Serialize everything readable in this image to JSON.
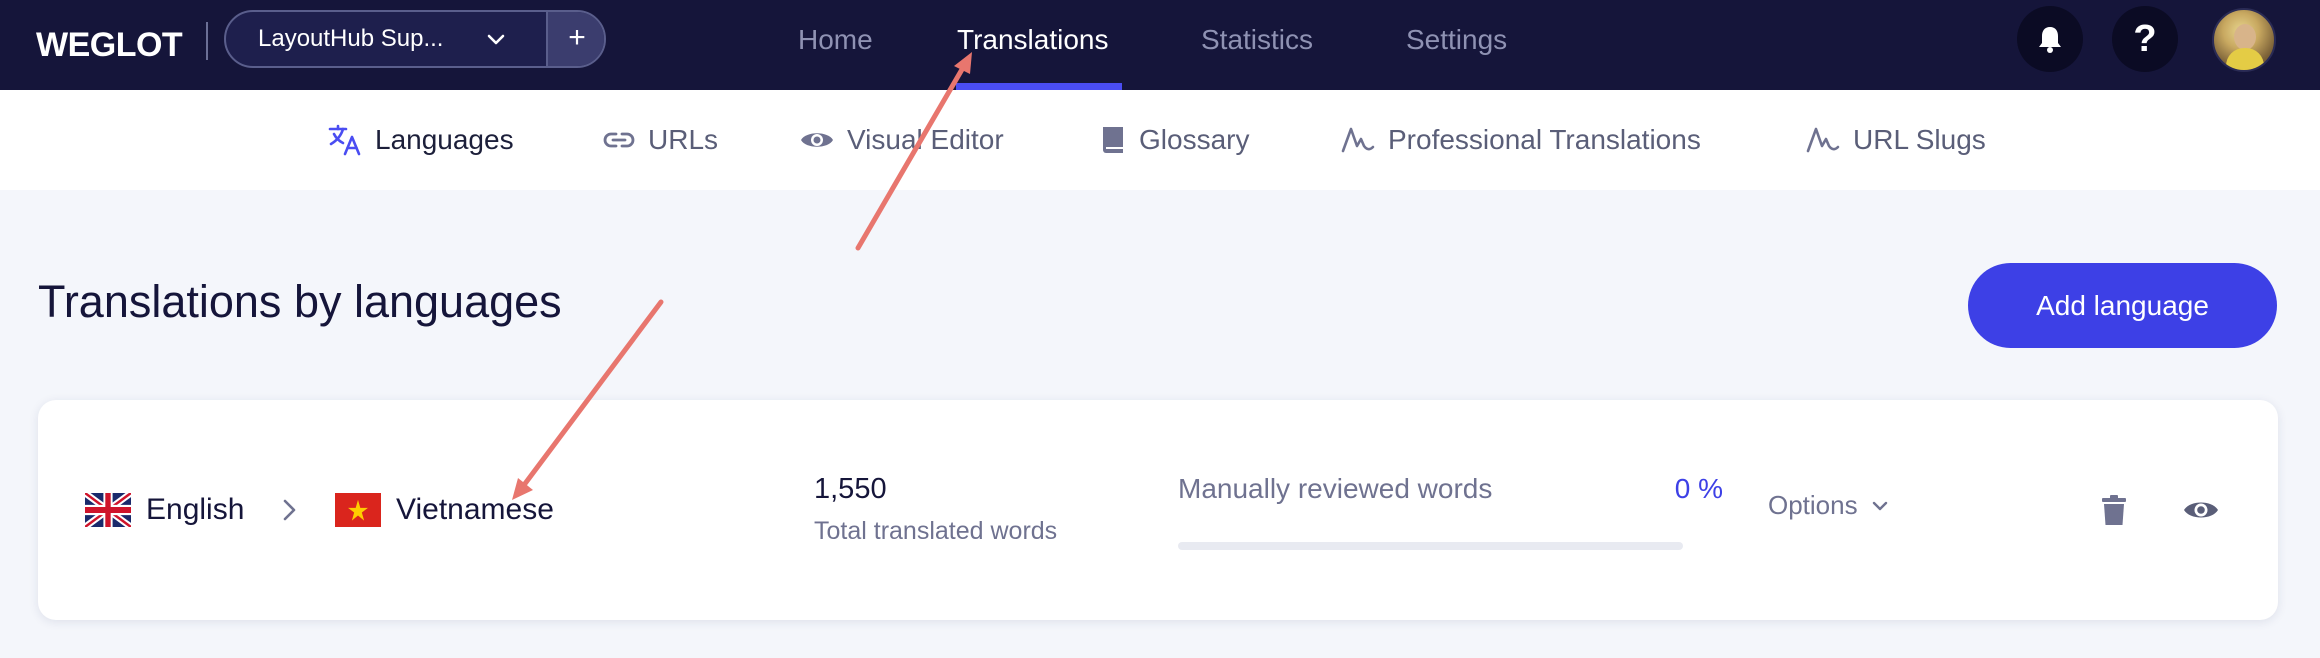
{
  "brand": {
    "logo_text": "WEGLOT"
  },
  "project": {
    "name": "LayoutHub Sup...",
    "add_label": "+"
  },
  "main_nav": [
    {
      "label": "Home",
      "active": false
    },
    {
      "label": "Translations",
      "active": true
    },
    {
      "label": "Statistics",
      "active": false
    },
    {
      "label": "Settings",
      "active": false
    }
  ],
  "header_actions": {
    "help_label": "?"
  },
  "sub_nav": [
    {
      "label": "Languages",
      "icon": "translate-icon",
      "active": true
    },
    {
      "label": "URLs",
      "icon": "link-icon",
      "active": false
    },
    {
      "label": "Visual Editor",
      "icon": "eye-icon",
      "active": false
    },
    {
      "label": "Glossary",
      "icon": "book-icon",
      "active": false
    },
    {
      "label": "Professional Translations",
      "icon": "signature-icon",
      "active": false
    },
    {
      "label": "URL Slugs",
      "icon": "signature-icon",
      "active": false
    }
  ],
  "page": {
    "title": "Translations by languages",
    "add_language_label": "Add language"
  },
  "language_pair": {
    "source": {
      "name": "English",
      "flag": "gb-flag-icon"
    },
    "target": {
      "name": "Vietnamese",
      "flag": "vn-flag-icon"
    },
    "translated_words": "1,550",
    "translated_words_label": "Total translated words",
    "reviewed_label": "Manually reviewed words",
    "reviewed_percent_text": "0 %",
    "reviewed_fraction": 0,
    "options_label": "Options"
  },
  "colors": {
    "nav_background": "#15153a",
    "accent": "#3d40e6",
    "annotation_arrow": "#e8766e"
  }
}
